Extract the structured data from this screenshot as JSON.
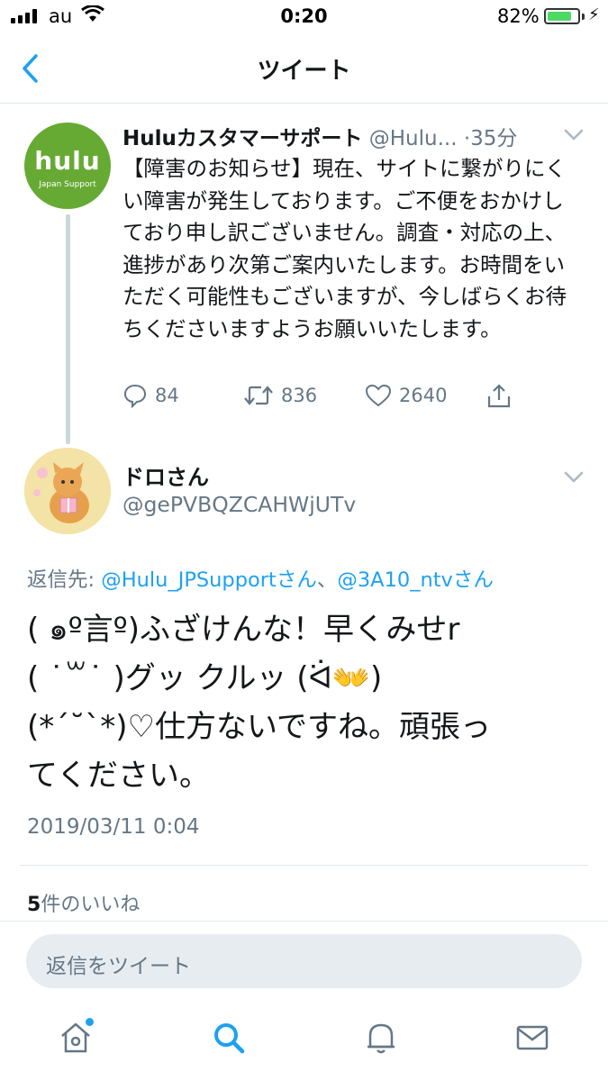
{
  "status_bar": {
    "carrier": "au",
    "time": "0:20",
    "battery": "82%",
    "battery_level": 0.82
  },
  "nav": {
    "title": "ツイート"
  },
  "original_tweet": {
    "avatar_word": "hulu",
    "avatar_sub": "Japan Support",
    "display_name": "Huluカスタマーサポート",
    "handle": "@Hulu...",
    "time_ago": "·35分",
    "text": "【障害のお知らせ】現在、サイトに繋がりにくい障害が発生しております。ご不便をおかけしており申し訳ございません。調査・対応の上、進捗があり次第ご案内いたします。お時間をいただく可能性もございますが、今しばらくお待ちくださいますようお願いいたします。",
    "replies": "84",
    "retweets": "836",
    "likes": "2640"
  },
  "reply_tweet": {
    "display_name": "ドロさん",
    "handle": "@gePVBQZCAHWjUTv",
    "reply_to_label": "返信先:",
    "reply_to_1": "@Hulu_JPSupportさん",
    "reply_to_sep": "、",
    "reply_to_2": "@3A10_ntvさん",
    "text_line1": "( ๑º言º)ふざけんな！早くみせr",
    "text_line2": "( ˙꒳˙ )グッ クルッ (ᐛ👐)",
    "text_line3": "(*´˘`*)♡仕方ないですね。頑張っ",
    "text_line4": "てください。",
    "timestamp": "2019/03/11 0:04",
    "likes_count": "5",
    "likes_label": "件のいいね"
  },
  "reply_box": {
    "placeholder": "返信をツイート"
  },
  "tabbar": {
    "items": [
      "home-icon",
      "search-icon",
      "notifications-icon",
      "messages-icon"
    ],
    "active_color": "#1da1f2"
  },
  "colors": {
    "accent": "#1da1f2",
    "hulu_green": "#66aa33",
    "muted": "#657786"
  }
}
